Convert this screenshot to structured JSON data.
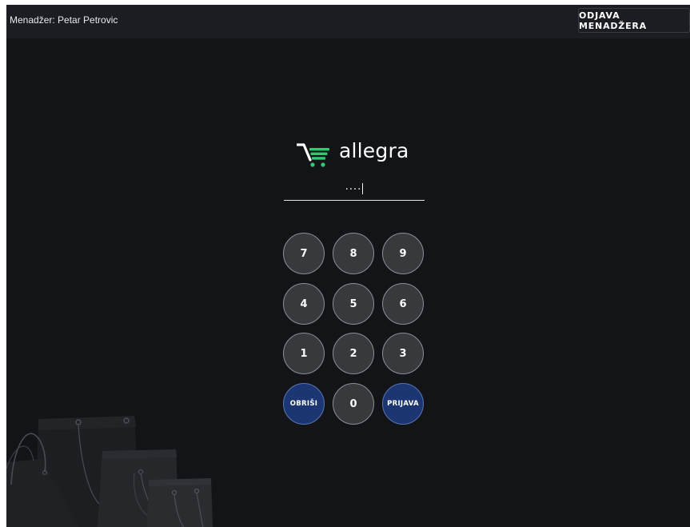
{
  "topbar": {
    "manager_label": "Menadžer: Petar Petrovic",
    "logout_label": "ODJAVA MENADŽERA"
  },
  "logo": {
    "text": "allegra",
    "icon": "shopping-cart-icon",
    "accent_color": "#2ecc71"
  },
  "pin": {
    "value": "····"
  },
  "keypad": {
    "keys": [
      "7",
      "8",
      "9",
      "4",
      "5",
      "6",
      "1",
      "2",
      "3"
    ],
    "delete_label": "OBRIŠI",
    "zero_label": "0",
    "login_label": "PRIJAVA"
  },
  "colors": {
    "background": "#131418",
    "topbar": "#1c1d22",
    "key_fill": "#38393d",
    "action_key_fill": "#1b3673"
  },
  "decoration": {
    "icon": "shopping-bags-illustration"
  }
}
